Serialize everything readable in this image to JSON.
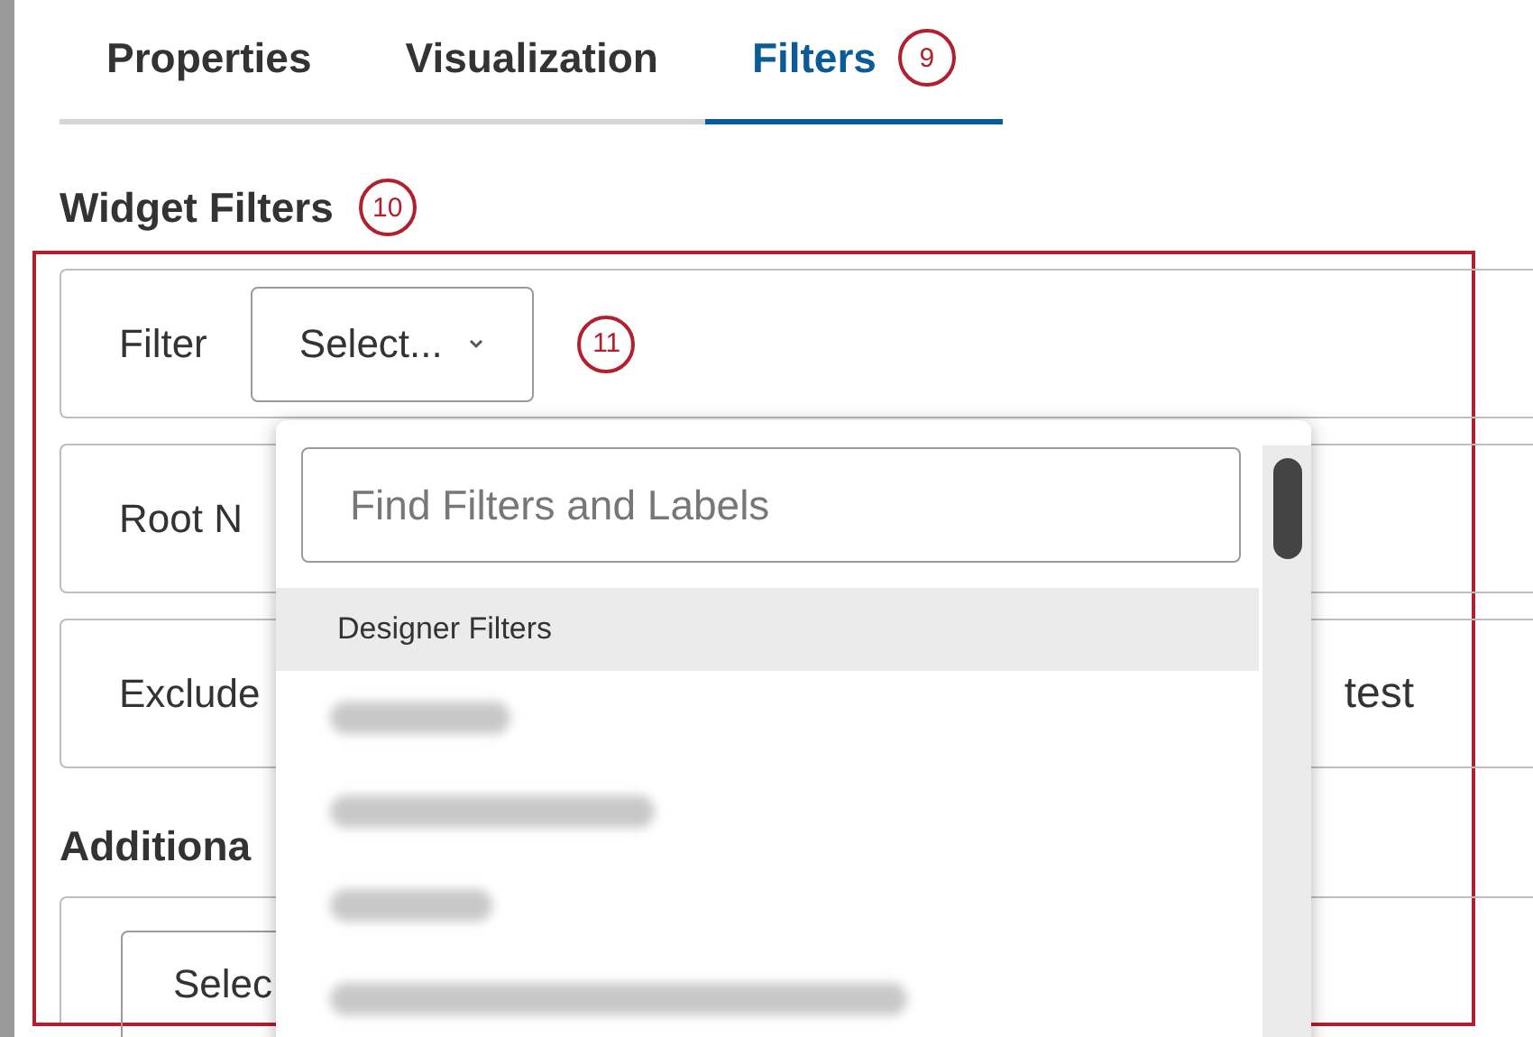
{
  "tabs": [
    {
      "label": "Properties",
      "selected": false
    },
    {
      "label": "Visualization",
      "selected": false
    },
    {
      "label": "Filters",
      "selected": true,
      "callout": "9"
    }
  ],
  "section": {
    "title": "Widget Filters",
    "callout": "10"
  },
  "rows": [
    {
      "label": "Filter",
      "select": "Select...",
      "callout": "11"
    },
    {
      "label": "Root N"
    },
    {
      "label": "Exclude",
      "trailing": "test"
    }
  ],
  "additional": {
    "title": "Additiona",
    "select": "Selec"
  },
  "dropdown": {
    "search_placeholder": "Find Filters and Labels",
    "group": "Designer Filters",
    "items": [
      {
        "kind": "blurred"
      },
      {
        "kind": "blurred"
      },
      {
        "kind": "blurred"
      },
      {
        "kind": "blurred"
      }
    ]
  }
}
